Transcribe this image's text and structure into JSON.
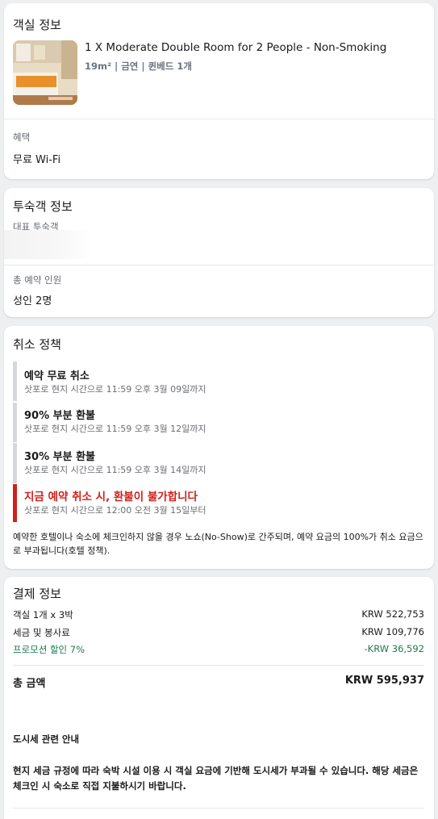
{
  "room": {
    "title": "객실 정보",
    "name": "1 X Moderate Double Room for 2 People - Non-Smoking",
    "details": "19m² | 금연 | 퀸베드 1개",
    "benefits_label": "혜택",
    "benefits_value": "무료 Wi-Fi"
  },
  "guest": {
    "title": "투숙객 정보",
    "lead_label": "대표 투숙객",
    "total_label": "총 예약 인원",
    "total_value": "성인 2명"
  },
  "cancel": {
    "title": "취소 정책",
    "items": [
      {
        "heading": "예약 무료 취소",
        "sub": "삿포로 현지 시간으로 11:59 오후 3월 09일까지"
      },
      {
        "heading": "90% 부분 환불",
        "sub": "삿포로 현지 시간으로 11:59 오후 3월 12일까지"
      },
      {
        "heading": "30% 부분 환불",
        "sub": "삿포로 현지 시간으로 11:59 오후 3월 14일까지"
      },
      {
        "heading": "지금 예약 취소 시, 환불이 불가합니다",
        "sub": "삿포로 현지 시간으로 12:00 오전 3월 15일부터"
      }
    ],
    "note": "예약한 호텔이나 숙소에 체크인하지 않을 경우 노쇼(No-Show)로 간주되며, 예약 요금의 100%가 취소 요금으로 부과됩니다(호텔 정책)."
  },
  "payment": {
    "title": "결제 정보",
    "rows": [
      {
        "label": "객실 1개 x 3박",
        "value": "KRW 522,753"
      },
      {
        "label": "세금 및 봉사료",
        "value": "KRW 109,776"
      },
      {
        "label": "프로모션 할인 7%",
        "value": "-KRW 36,592"
      }
    ],
    "total_label": "총 금액",
    "total_value": "KRW 595,937",
    "city_tax_title": "도시세 관련 안내",
    "city_tax_text": "현지 세금 규정에 따라 숙박 시설 이용 시 객실 요금에 기반해 도시세가 부과될 수 있습니다. 해당 세금은 체크인 시 숙소로 직접 지불하시기 바랍니다."
  },
  "colors": {
    "danger": "#d0211b",
    "discount": "#1e7a4e",
    "timeline_gray": "#d5d7db"
  }
}
